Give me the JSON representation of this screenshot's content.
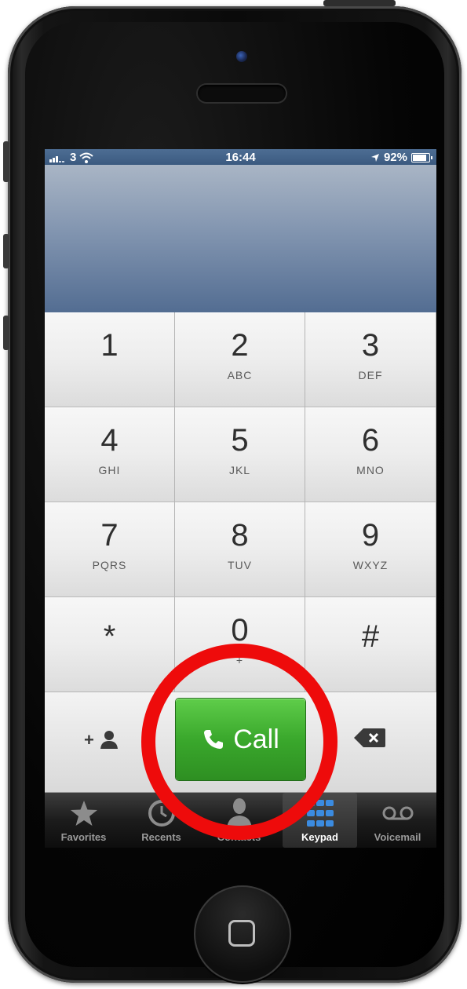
{
  "status_bar": {
    "carrier": "3",
    "time": "16:44",
    "battery": "92%",
    "icons": [
      "signal-bars-icon",
      "wifi-icon",
      "location-arrow-icon",
      "battery-icon"
    ]
  },
  "keypad": {
    "keys": [
      {
        "num": "1",
        "letters": ""
      },
      {
        "num": "2",
        "letters": "ABC"
      },
      {
        "num": "3",
        "letters": "DEF"
      },
      {
        "num": "4",
        "letters": "GHI"
      },
      {
        "num": "5",
        "letters": "JKL"
      },
      {
        "num": "6",
        "letters": "MNO"
      },
      {
        "num": "7",
        "letters": "PQRS"
      },
      {
        "num": "8",
        "letters": "TUV"
      },
      {
        "num": "9",
        "letters": "WXYZ"
      },
      {
        "num": "*",
        "letters": ""
      },
      {
        "num": "0",
        "letters": "+"
      },
      {
        "num": "#",
        "letters": ""
      }
    ]
  },
  "actions": {
    "add_contact": "+",
    "call_label": "Call",
    "icons": [
      "add-contact-icon",
      "phone-icon",
      "backspace-icon"
    ]
  },
  "tabbar": {
    "tabs": [
      {
        "label": "Favorites",
        "icon": "star-icon"
      },
      {
        "label": "Recents",
        "icon": "clock-icon"
      },
      {
        "label": "Contacts",
        "icon": "person-icon"
      },
      {
        "label": "Keypad",
        "icon": "keypad-icon"
      },
      {
        "label": "Voicemail",
        "icon": "voicemail-icon"
      }
    ],
    "active": "Keypad"
  },
  "colors": {
    "call_green": "#3aa82c",
    "highlight_red": "#ee0b0b",
    "status_bar_blue": "#3b5a80"
  }
}
